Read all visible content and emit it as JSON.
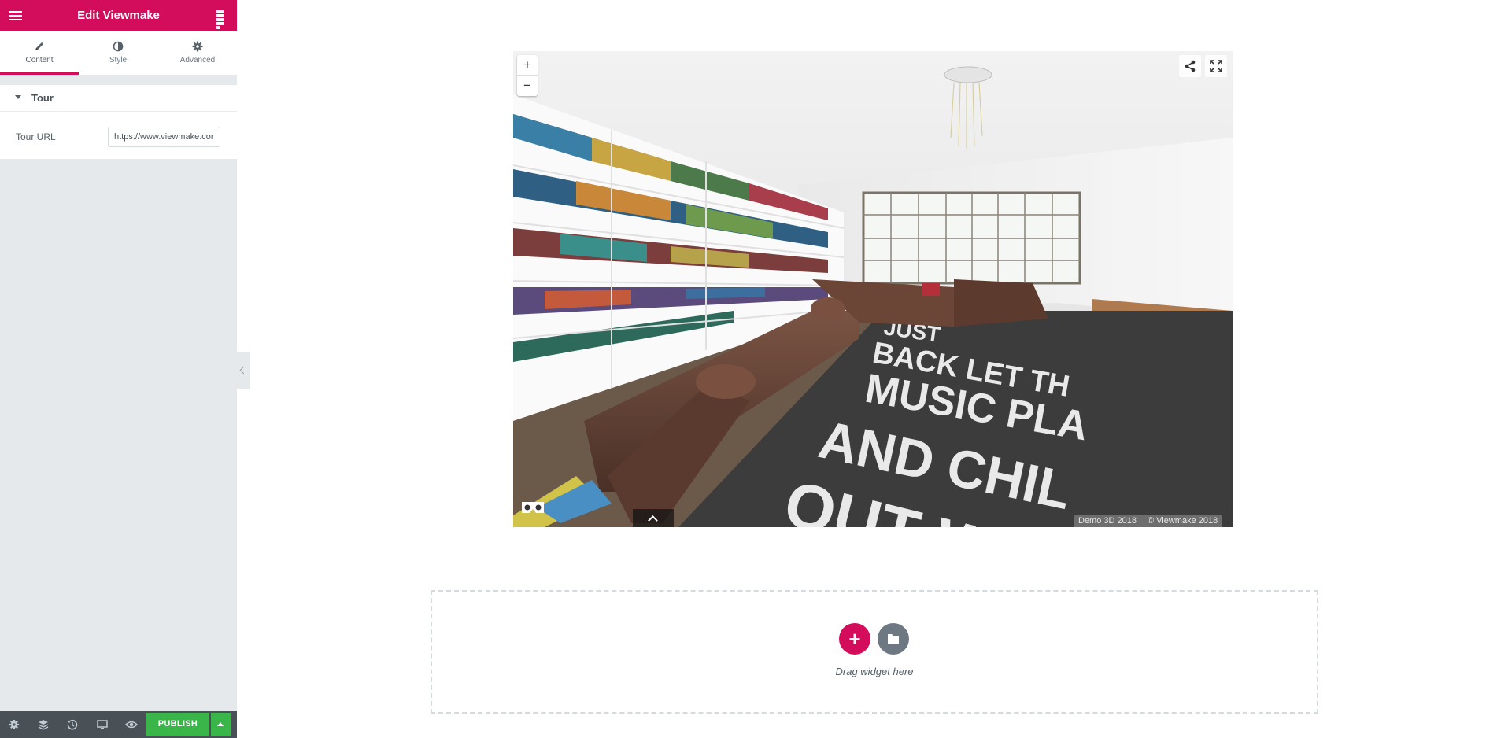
{
  "panel": {
    "title": "Edit Viewmake",
    "tabs": [
      {
        "label": "Content",
        "icon": "pencil-icon"
      },
      {
        "label": "Style",
        "icon": "half-circle-icon"
      },
      {
        "label": "Advanced",
        "icon": "gear-icon"
      }
    ],
    "section": {
      "title": "Tour",
      "field_label": "Tour URL",
      "field_value": "https://www.viewmake.com/"
    },
    "footer": {
      "publish_label": "PUBLISH",
      "icons": [
        "settings-icon",
        "navigator-icon",
        "history-icon",
        "responsive-icon",
        "preview-icon"
      ]
    }
  },
  "tour": {
    "zoom_in": "+",
    "zoom_out": "−",
    "credit_left": "Demo 3D 2018",
    "credit_right": "© Viewmake 2018",
    "carpet_text": [
      "JUST",
      "BACK LET TH",
      "MUSIC PLA",
      "AND CHIL",
      "OUT W"
    ]
  },
  "dropzone": {
    "text": "Drag widget here",
    "add_symbol": "+"
  },
  "colors": {
    "accent": "#d30c5c",
    "publish": "#39b54a",
    "panel_bg": "#e6e9ec",
    "footer_bg": "#495157"
  }
}
